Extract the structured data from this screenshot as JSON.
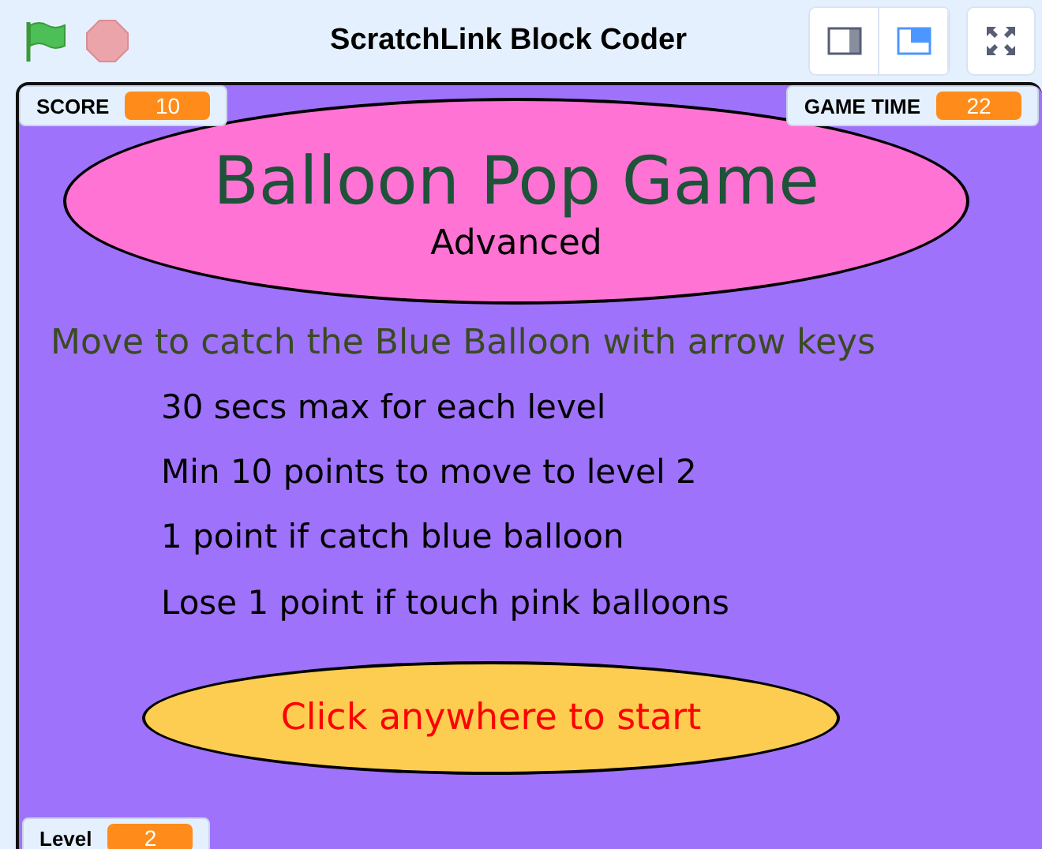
{
  "header": {
    "title": "ScratchLink Block Coder",
    "layout_modes": [
      {
        "selected": false
      },
      {
        "selected": true
      }
    ]
  },
  "top_monitors": [
    {
      "label": "SCORE",
      "value": "10"
    },
    {
      "label": "GAME TIME",
      "value": "22"
    }
  ],
  "bottom_monitors": [
    {
      "label": "Level",
      "value": "2"
    }
  ],
  "stage": {
    "title": "Balloon Pop Game",
    "subtitle": "Advanced",
    "instruction": "Move to catch the Blue Balloon with arrow keys",
    "rules": [
      "30 secs max for each level",
      "Min 10 points to move to level 2",
      "1 point if catch blue balloon",
      "Lose 1 point if touch pink balloons"
    ],
    "start_button": "Click anywhere to start"
  }
}
